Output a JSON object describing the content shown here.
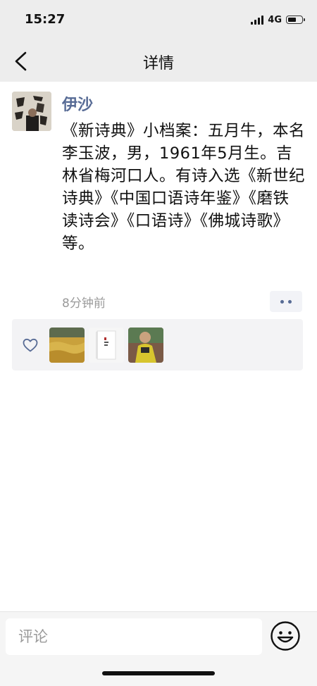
{
  "status_bar": {
    "time": "15:27",
    "network": "4G",
    "signal_bars": 4,
    "battery_level": 0.55
  },
  "nav": {
    "title": "详情",
    "back_icon": "chevron-left-icon"
  },
  "post": {
    "author": "伊沙",
    "text": "《新诗典》小档案：五月牛，本名李玉波，男，1961年5月生。吉林省梅河口人。有诗入选《新世纪诗典》《中国口语诗年鉴》《磨铁读诗会》《口语诗》《佛城诗歌》等。",
    "time_ago": "8分钟前",
    "more_icon": "more-dots-icon"
  },
  "likes": {
    "icon": "heart-icon",
    "avatars": [
      "wheat-field-avatar",
      "book-avatar",
      "person-avatar"
    ]
  },
  "comment_bar": {
    "placeholder": "评论",
    "emoji_icon": "smiley-icon"
  },
  "colors": {
    "accent": "#576b95",
    "header_bg": "#ededed",
    "muted_text": "#9a9a9a"
  }
}
